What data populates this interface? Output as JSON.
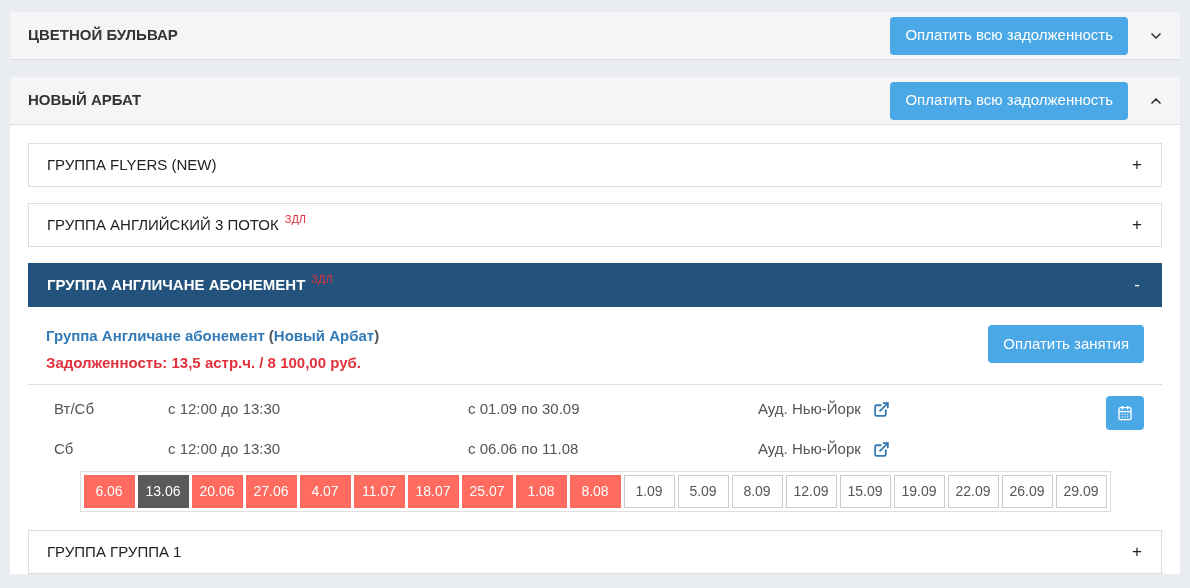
{
  "branches": [
    {
      "title": "ЦВЕТНОЙ БУЛЬВАР",
      "pay_button": "Оплатить всю задолженность",
      "expanded": false
    },
    {
      "title": "НОВЫЙ АРБАТ",
      "pay_button": "Оплатить всю задолженность",
      "expanded": true,
      "groups": [
        {
          "title": "ГРУППА FLYERS (NEW)",
          "expanded": false,
          "toggle": "+"
        },
        {
          "title": "ГРУППА АНГЛИЙСКИЙ 3 ПОТОК",
          "badge": "ЗДЛ",
          "expanded": false,
          "toggle": "+"
        },
        {
          "title": "ГРУППА АНГЛИЧАНЕ АБОНЕМЕНТ",
          "badge": "ЗДЛ",
          "expanded": true,
          "toggle": "-",
          "details": {
            "name": "Группа Англичане абонемент",
            "paren_open": "(",
            "branch": "Новый Арбат",
            "paren_close": ")",
            "debt": "Задолженность: 13,5 астр.ч. / 8 100,00 руб.",
            "pay_button": "Оплатить занятия",
            "schedule": [
              {
                "days": "Вт/Сб",
                "time": "с 12:00 до 13:30",
                "period": "с 01.09 по 30.09",
                "room": "Ауд. Нью-Йорк"
              },
              {
                "days": "Сб",
                "time": "с 12:00 до 13:30",
                "period": "с 06.06 по 11.08",
                "room": "Ауд. Нью-Йорк"
              }
            ],
            "lessons": [
              {
                "date": "6.06",
                "kind": "debt"
              },
              {
                "date": "13.06",
                "kind": "current"
              },
              {
                "date": "20.06",
                "kind": "debt"
              },
              {
                "date": "27.06",
                "kind": "debt"
              },
              {
                "date": "4.07",
                "kind": "debt"
              },
              {
                "date": "11.07",
                "kind": "debt"
              },
              {
                "date": "18.07",
                "kind": "debt"
              },
              {
                "date": "25.07",
                "kind": "debt"
              },
              {
                "date": "1.08",
                "kind": "debt"
              },
              {
                "date": "8.08",
                "kind": "debt"
              },
              {
                "date": "1.09",
                "kind": "future"
              },
              {
                "date": "5.09",
                "kind": "future"
              },
              {
                "date": "8.09",
                "kind": "future"
              },
              {
                "date": "12.09",
                "kind": "future"
              },
              {
                "date": "15.09",
                "kind": "future"
              },
              {
                "date": "19.09",
                "kind": "future"
              },
              {
                "date": "22.09",
                "kind": "future"
              },
              {
                "date": "26.09",
                "kind": "future"
              },
              {
                "date": "29.09",
                "kind": "future"
              }
            ]
          }
        },
        {
          "title": "ГРУППА ГРУППА 1",
          "expanded": false,
          "toggle": "+"
        }
      ]
    }
  ]
}
